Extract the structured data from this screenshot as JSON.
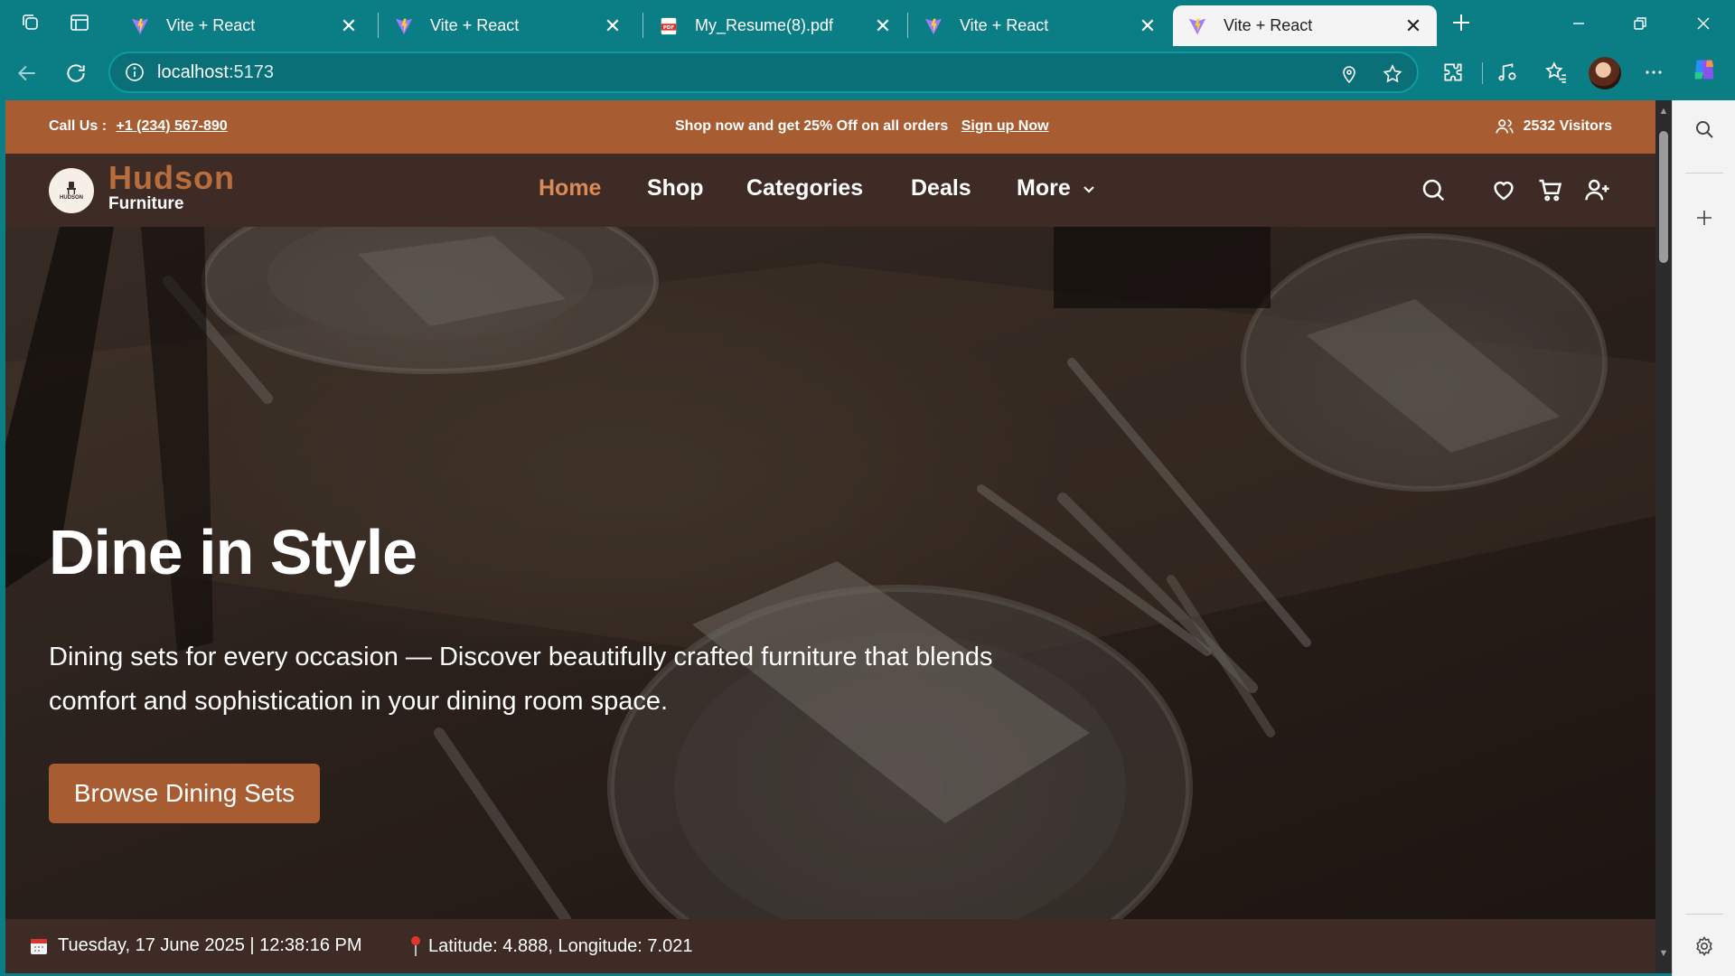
{
  "browser": {
    "tabs": [
      {
        "title": "Vite + React",
        "favicon": "vite-icon"
      },
      {
        "title": "Vite + React",
        "favicon": "vite-icon"
      },
      {
        "title": "My_Resume(8).pdf",
        "favicon": "pdf-icon"
      },
      {
        "title": "Vite + React",
        "favicon": "vite-icon"
      },
      {
        "title": "Vite + React",
        "favicon": "vite-icon",
        "active": true
      }
    ],
    "url_host": "localhost",
    "url_port": ":5173",
    "accent_color": "#0b7d85"
  },
  "promo": {
    "call_label": "Call Us  :",
    "phone": "+1 (234) 567-890",
    "offer": "Shop now and get 25% Off on all orders",
    "signup": "Sign up Now",
    "visitors": "2532 Visitors"
  },
  "header": {
    "logo_mini": "HUDSON",
    "brand_name": "Hudson",
    "brand_sub": "Furniture",
    "menu": {
      "home": "Home",
      "shop": "Shop",
      "categories": "Categories",
      "deals": "Deals",
      "more": "More"
    }
  },
  "hero": {
    "title": "Dine in Style",
    "description": "Dining sets for every occasion — Discover beautifully crafted furniture that blends comfort and sophistication in your dining room space.",
    "cta": "Browse Dining Sets"
  },
  "footer": {
    "datetime": "Tuesday, 17 June 2025 | 12:38:16 PM",
    "location": "Latitude: 4.888, Longitude: 7.021"
  },
  "colors": {
    "brand_orange": "#a75c32",
    "brand_dark": "#3e2b26",
    "active_menu": "#d98a56"
  }
}
